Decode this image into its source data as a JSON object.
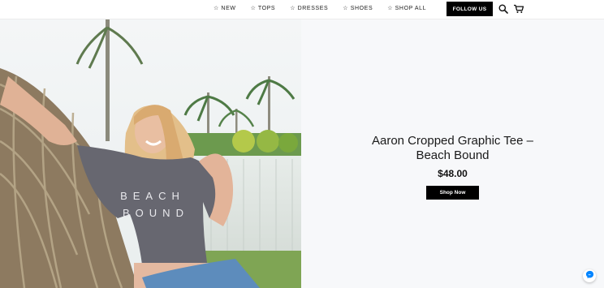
{
  "nav": {
    "items": [
      {
        "label": "☆ NEW"
      },
      {
        "label": "☆ TOPS"
      },
      {
        "label": "☆ DRESSES"
      },
      {
        "label": "☆ SHOES"
      },
      {
        "label": "☆ SHOP ALL"
      }
    ],
    "follow_label": "FOLLOW US",
    "icons": [
      "search-icon",
      "cart-icon"
    ]
  },
  "hero": {
    "shirt_text_line1": "BEACH",
    "shirt_text_line2": "BOUND",
    "product_title_line1": "Aaron Cropped Graphic Tee –",
    "product_title_line2": "Beach Bound",
    "price": "$48.00",
    "cta_label": "Shop Now"
  },
  "colors": {
    "accent": "#000000",
    "panel_bg": "#f7f8fa",
    "messenger": "#0084ff"
  }
}
